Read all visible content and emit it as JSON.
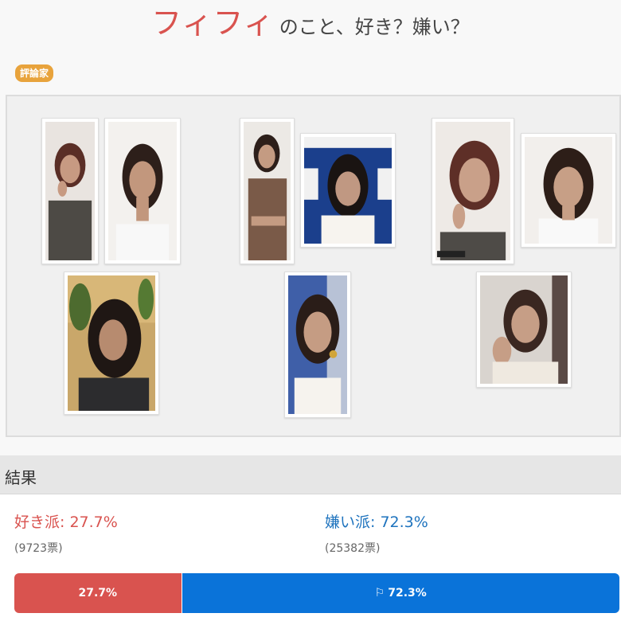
{
  "title": {
    "name": "フィフィ",
    "question": "のこと、好き？嫌い？"
  },
  "badge": "評論家",
  "gallery": {
    "photos": [
      {
        "label": "portrait-hand-on-chin"
      },
      {
        "label": "portrait-smiling"
      },
      {
        "label": "portrait-plants-background"
      },
      {
        "label": "portrait-arms-crossed"
      },
      {
        "label": "portrait-bookstore-backdrop"
      },
      {
        "label": "portrait-earrings"
      },
      {
        "label": "portrait-hand-on-chin-2"
      },
      {
        "label": "portrait-smiling-2"
      },
      {
        "label": "portrait-indoor"
      }
    ]
  },
  "results": {
    "header": "結果",
    "like": {
      "label": "好き派:",
      "percent": "27.7%",
      "votes": "(9723票)",
      "fraction": 0.277,
      "color": "#d9534f"
    },
    "dislike": {
      "label": "嫌い派:",
      "percent": "72.3%",
      "votes": "(25382票)",
      "fraction": 0.723,
      "color": "#0a73d9"
    },
    "bar": {
      "like_text": "27.7%",
      "dislike_text": "72.3%",
      "dislike_icon": "flag-icon"
    }
  }
}
